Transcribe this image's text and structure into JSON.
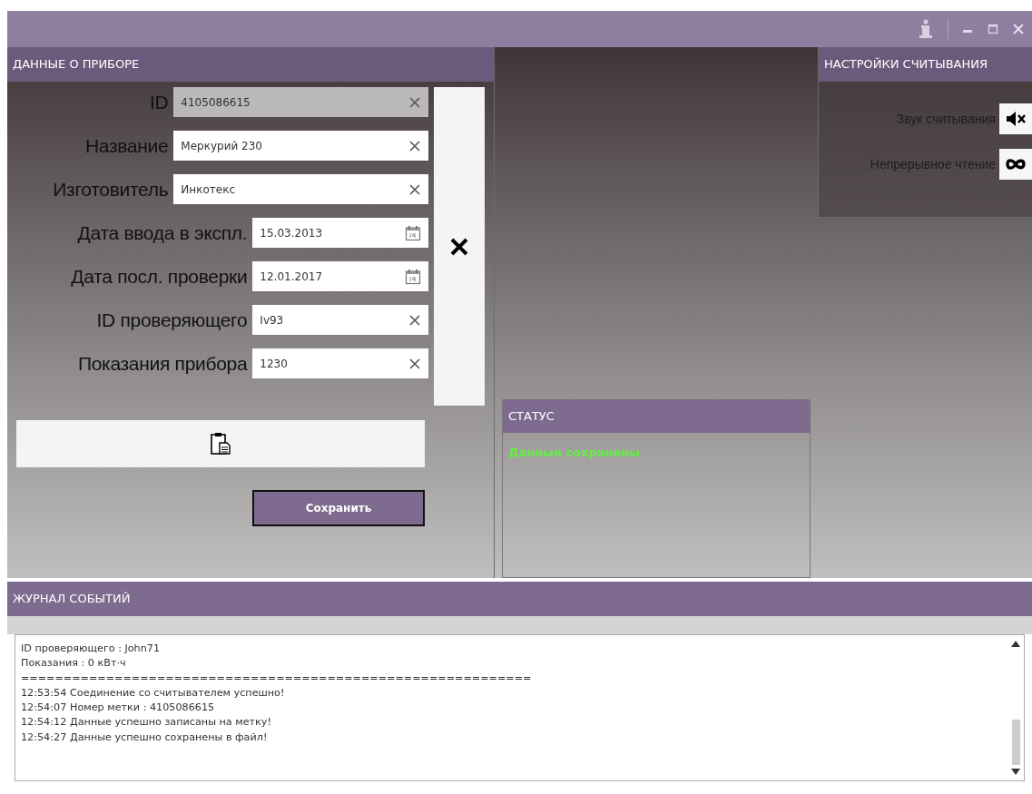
{
  "device_panel": {
    "title": "ДАННЫЕ О ПРИБОРЕ",
    "fields": [
      {
        "label": "ID",
        "value": "4105086615",
        "kind": "text",
        "disabled": true
      },
      {
        "label": "Название",
        "value": "Меркурий 230",
        "kind": "text",
        "disabled": false
      },
      {
        "label": "Изготовитель",
        "value": "Инкотекс",
        "kind": "text",
        "disabled": false
      },
      {
        "label": "Дата ввода в экспл.",
        "value": "15.03.2013",
        "kind": "date",
        "disabled": false
      },
      {
        "label": "Дата посл. проверки",
        "value": "12.01.2017",
        "kind": "date",
        "disabled": false
      },
      {
        "label": "ID проверяющего",
        "value": "Iv93",
        "kind": "text",
        "disabled": false
      },
      {
        "label": "Показания прибора",
        "value": "1230",
        "kind": "text",
        "disabled": false
      }
    ],
    "save_button": "Сохранить"
  },
  "settings_panel": {
    "title": "НАСТРОЙКИ СЧИТЫВАНИЯ",
    "items": [
      {
        "label": "Звук считывания",
        "kind": "mute"
      },
      {
        "label": "Непрерывное чтение",
        "kind": "loop"
      }
    ]
  },
  "status_panel": {
    "title": "СТАТУС",
    "message": "Данные сохранены"
  },
  "log_panel": {
    "title": "ЖУРНАЛ СОБЫТИЙ",
    "lines": [
      {
        "text": "ID проверяющего : John71"
      },
      {
        "text": "Показания : 0 кВт·ч"
      },
      {
        "text": "============================================================"
      },
      {
        "time": "12:53:54",
        "text": "Соединение со считывателем успешно!"
      },
      {
        "time": "12:54:07",
        "text": "Номер метки : 4105086615"
      },
      {
        "time": "12:54:12",
        "text": "Данные успешно записаны на метку!"
      },
      {
        "time": "12:54:27",
        "text": "Данные успешно сохранены в файл!"
      }
    ]
  }
}
